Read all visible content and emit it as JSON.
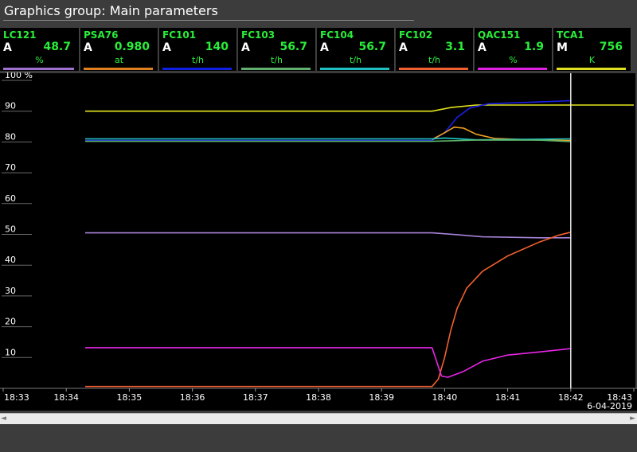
{
  "window": {
    "title": "Graphics group: Main parameters"
  },
  "tags": [
    {
      "name": "LC121",
      "mode": "A",
      "value": "48.7",
      "unit": "%",
      "color": "#a070d0"
    },
    {
      "name": "PSA76",
      "mode": "A",
      "value": "0.980",
      "unit": "at",
      "color": "#e08020"
    },
    {
      "name": "FC101",
      "mode": "A",
      "value": "140",
      "unit": "t/h",
      "color": "#1020e0"
    },
    {
      "name": "FC103",
      "mode": "A",
      "value": "56.7",
      "unit": "t/h",
      "color": "#60b070"
    },
    {
      "name": "FC104",
      "mode": "A",
      "value": "56.7",
      "unit": "t/h",
      "color": "#20c0c0"
    },
    {
      "name": "FC102",
      "mode": "A",
      "value": "3.1",
      "unit": "t/h",
      "color": "#f06030"
    },
    {
      "name": "QAC151",
      "mode": "A",
      "value": "1.9",
      "unit": "%",
      "color": "#e020e0"
    },
    {
      "name": "TCA1",
      "mode": "M",
      "value": "756",
      "unit": "K",
      "color": "#e0e020"
    }
  ],
  "date": "6-04-2019",
  "scroll": {
    "left": "◄",
    "right": "►"
  },
  "chart_data": {
    "type": "line",
    "ylabel_unit": "%",
    "ylim": [
      0,
      100
    ],
    "y_ticks": [
      10,
      20,
      30,
      40,
      50,
      60,
      70,
      80,
      90,
      100
    ],
    "y_tick_labels": [
      "10",
      "20",
      "30",
      "40",
      "50",
      "60",
      "70",
      "80",
      "90",
      "100 %"
    ],
    "x_ticks": [
      "18:33",
      "18:34",
      "18:35",
      "18:36",
      "18:37",
      "18:38",
      "18:39",
      "18:40",
      "18:41",
      "18:42",
      "18:43"
    ],
    "x_range_minutes": [
      0,
      10
    ],
    "cursor_time": "18:42",
    "grid": false,
    "series": [
      {
        "name": "TCA1",
        "color": "#e6e61e",
        "points": [
          [
            1.3,
            90
          ],
          [
            6.8,
            90
          ],
          [
            7.1,
            91.2
          ],
          [
            7.5,
            92
          ],
          [
            9.0,
            92
          ],
          [
            10,
            92
          ]
        ]
      },
      {
        "name": "FC101",
        "color": "#1a20e8",
        "points": [
          [
            1.3,
            80.5
          ],
          [
            6.8,
            80.5
          ],
          [
            7.0,
            83
          ],
          [
            7.2,
            88
          ],
          [
            7.4,
            91
          ],
          [
            7.7,
            92.4
          ],
          [
            8.5,
            93
          ],
          [
            9.0,
            93.4
          ]
        ]
      },
      {
        "name": "PSA76",
        "color": "#f0a020",
        "points": [
          [
            6.8,
            80.8
          ],
          [
            7.0,
            83
          ],
          [
            7.15,
            84.8
          ],
          [
            7.3,
            84.5
          ],
          [
            7.5,
            82.5
          ],
          [
            7.8,
            81.1
          ],
          [
            8.5,
            80.6
          ],
          [
            9.0,
            80.5
          ]
        ]
      },
      {
        "name": "FC104",
        "color": "#20c8c8",
        "points": [
          [
            1.3,
            81
          ],
          [
            6.8,
            81
          ],
          [
            7.0,
            81.3
          ],
          [
            7.5,
            80.7
          ],
          [
            9.0,
            81
          ]
        ]
      },
      {
        "name": "FC103",
        "color": "#5ab46a",
        "points": [
          [
            1.3,
            80.2
          ],
          [
            6.8,
            80.2
          ],
          [
            7.5,
            80.6
          ],
          [
            8.5,
            80.6
          ],
          [
            9.0,
            80.1
          ]
        ]
      },
      {
        "name": "LC121",
        "color": "#a882d8",
        "points": [
          [
            1.3,
            50.5
          ],
          [
            6.8,
            50.5
          ],
          [
            7.2,
            49.9
          ],
          [
            7.6,
            49.2
          ],
          [
            8.5,
            48.9
          ],
          [
            9.0,
            48.9
          ]
        ]
      },
      {
        "name": "FC102",
        "color": "#f26030",
        "points": [
          [
            1.3,
            0.6
          ],
          [
            6.8,
            0.6
          ],
          [
            6.9,
            3
          ],
          [
            7.0,
            10
          ],
          [
            7.1,
            19
          ],
          [
            7.2,
            26
          ],
          [
            7.35,
            32.5
          ],
          [
            7.6,
            38
          ],
          [
            8.0,
            43
          ],
          [
            8.5,
            47.5
          ],
          [
            8.8,
            49.7
          ],
          [
            9.0,
            50.7
          ]
        ]
      },
      {
        "name": "QAC151",
        "color": "#e826e8",
        "points": [
          [
            1.3,
            13.2
          ],
          [
            6.8,
            13.2
          ],
          [
            6.87,
            9
          ],
          [
            6.95,
            4
          ],
          [
            7.05,
            3.6
          ],
          [
            7.3,
            5.5
          ],
          [
            7.6,
            8.8
          ],
          [
            8.0,
            10.8
          ],
          [
            8.5,
            11.8
          ],
          [
            9.0,
            12.9
          ]
        ]
      }
    ]
  }
}
